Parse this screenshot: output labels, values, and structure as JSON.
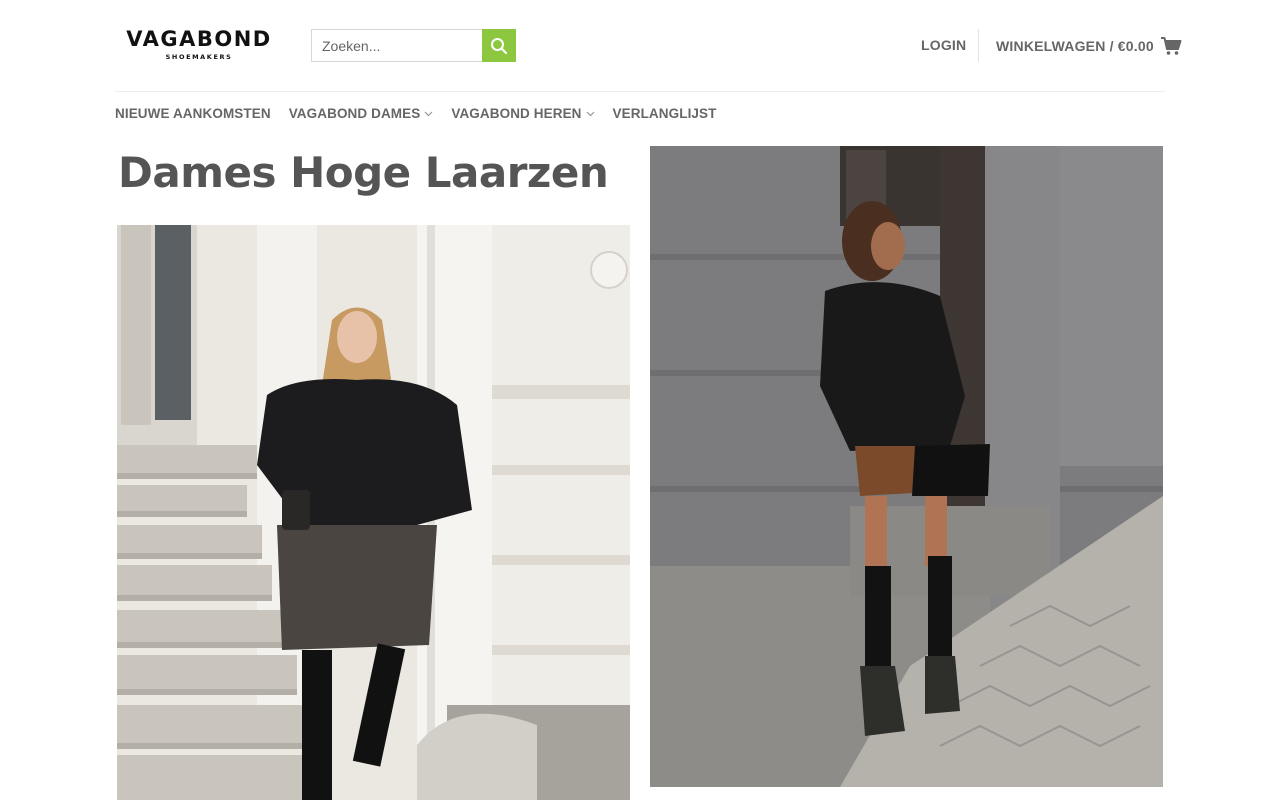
{
  "header": {
    "logo": {
      "main": "VAGABOND",
      "sub": "SHOEMAKERS"
    },
    "search": {
      "placeholder": "Zoeken...",
      "icon": "search-icon"
    },
    "login_label": "LOGIN",
    "cart": {
      "label": "WINKELWAGEN / €0.00",
      "icon": "shopping-cart-icon"
    }
  },
  "nav": {
    "items": [
      {
        "label": "NIEUWE AANKOMSTEN",
        "has_dropdown": false
      },
      {
        "label": "VAGABOND DAMES",
        "has_dropdown": true
      },
      {
        "label": "VAGABOND HEREN",
        "has_dropdown": true
      },
      {
        "label": "VERLANGLIJST",
        "has_dropdown": false
      }
    ]
  },
  "main": {
    "title": "Dames Hoge Laarzen"
  },
  "colors": {
    "accent": "#8dc63f",
    "text": "#555555",
    "nav_text": "#666666",
    "divider": "#ececec"
  }
}
